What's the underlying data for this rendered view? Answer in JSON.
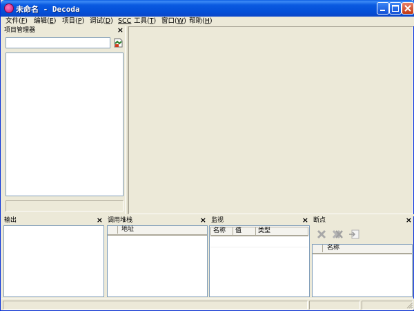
{
  "window": {
    "title": "未命名 - Decoda"
  },
  "menu": [
    {
      "label": "文件",
      "key": "F"
    },
    {
      "label": "编辑",
      "key": "E"
    },
    {
      "label": "项目",
      "key": "P"
    },
    {
      "label": "调试",
      "key": "D"
    },
    {
      "label": "SCC",
      "key": ""
    },
    {
      "label": "工具",
      "key": "T"
    },
    {
      "label": "窗口",
      "key": "W"
    },
    {
      "label": "帮助",
      "key": "H"
    }
  ],
  "project_manager": {
    "title": "项目管理器",
    "search_value": ""
  },
  "output": {
    "title": "输出"
  },
  "callstack": {
    "title": "调用堆栈",
    "columns": [
      "",
      "地址"
    ]
  },
  "watch": {
    "title": "监视",
    "columns": [
      "名称",
      "值",
      "类型"
    ]
  },
  "breakpoints": {
    "title": "断点",
    "columns": [
      "",
      "名称"
    ],
    "toolbar": [
      "delete-breakpoint-icon",
      "delete-all-breakpoints-icon",
      "goto-breakpoint-icon"
    ]
  },
  "close_glyph": "×"
}
